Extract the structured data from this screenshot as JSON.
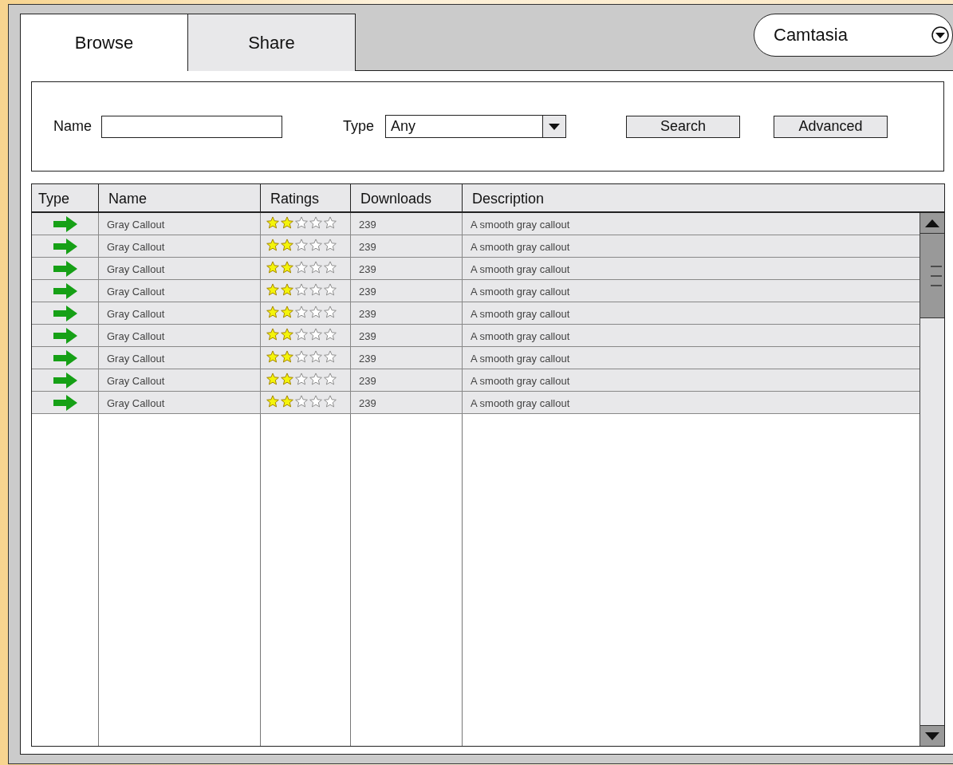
{
  "tabs": [
    {
      "label": "Browse",
      "selected": true
    },
    {
      "label": "Share",
      "selected": false
    }
  ],
  "product_dropdown": {
    "value": "Camtasia"
  },
  "search": {
    "name_label": "Name",
    "type_label": "Type",
    "type_value": "Any",
    "buttons": [
      "Search",
      "Advanced"
    ]
  },
  "table": {
    "columns": [
      "Type",
      "Name",
      "Ratings",
      "Downloads",
      "Description"
    ],
    "rows": [
      {
        "name": "Gray Callout",
        "stars": 2,
        "downloads": "239",
        "description": "A smooth gray callout"
      },
      {
        "name": "Gray Callout",
        "stars": 2,
        "downloads": "239",
        "description": "A smooth gray callout"
      },
      {
        "name": "Gray Callout",
        "stars": 2,
        "downloads": "239",
        "description": "A smooth gray callout"
      },
      {
        "name": "Gray Callout",
        "stars": 2,
        "downloads": "239",
        "description": "A smooth gray callout"
      },
      {
        "name": "Gray Callout",
        "stars": 2,
        "downloads": "239",
        "description": "A smooth gray callout"
      },
      {
        "name": "Gray Callout",
        "stars": 2,
        "downloads": "239",
        "description": "A smooth gray callout"
      },
      {
        "name": "Gray Callout",
        "stars": 2,
        "downloads": "239",
        "description": "A smooth gray callout"
      },
      {
        "name": "Gray Callout",
        "stars": 2,
        "downloads": "239",
        "description": "A smooth gray callout"
      },
      {
        "name": "Gray Callout",
        "stars": 2,
        "downloads": "239",
        "description": "A smooth gray callout"
      }
    ]
  }
}
